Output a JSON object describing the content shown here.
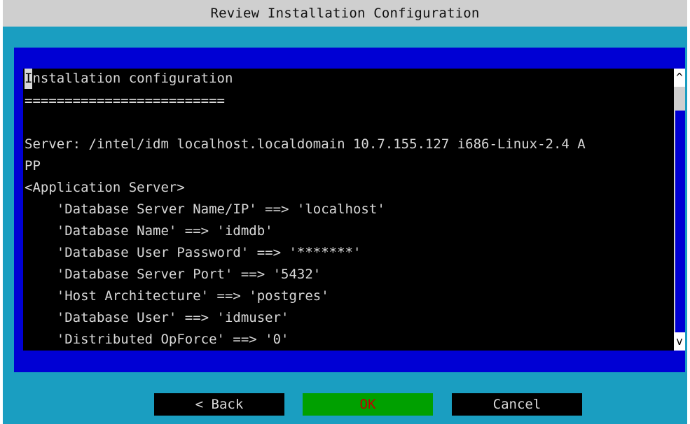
{
  "window": {
    "title": "Review Installation Configuration"
  },
  "content": {
    "cursor_char": "I",
    "first_line_rest": "nstallation configuration",
    "lines": [
      "=========================",
      "",
      "Server: /intel/idm localhost.localdomain 10.7.155.127 i686-Linux-2.4 A",
      "PP",
      "<Application Server>",
      "    'Database Server Name/IP' ==> 'localhost'",
      "    'Database Name' ==> 'idmdb'",
      "    'Database User Password' ==> '*******'",
      "    'Database Server Port' ==> '5432'",
      "    'Host Architecture' ==> 'postgres'",
      "    'Database User' ==> 'idmuser'",
      "    'Distributed OpForce' ==> '0'"
    ]
  },
  "scrollbar": {
    "up_arrow": "^",
    "down_arrow": "v"
  },
  "buttons": {
    "back": "< Back",
    "ok": "OK",
    "cancel": "Cancel"
  },
  "colors": {
    "background": "#1a9ec1",
    "dialog": "#0000d4",
    "text_area": "#000000",
    "ok_button": "#00a000",
    "ok_text": "#c00000"
  }
}
